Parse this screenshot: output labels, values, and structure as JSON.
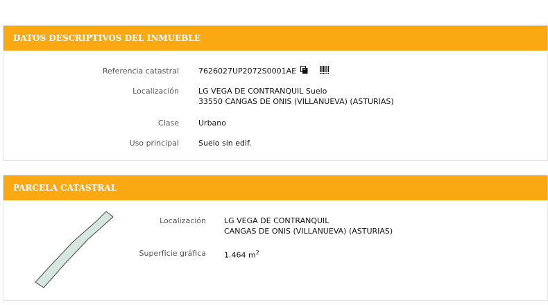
{
  "datos": {
    "title": "DATOS DESCRIPTIVOS DEL INMUEBLE",
    "referencia_label": "Referencia catastral",
    "referencia_value": "7626027UP2072S0001AE",
    "localizacion_label": "Localización",
    "localizacion_line1": "LG VEGA DE CONTRANQUIL Suelo",
    "localizacion_line2": "33550 CANGAS DE ONIS (VILLANUEVA) (ASTURIAS)",
    "clase_label": "Clase",
    "clase_value": "Urbano",
    "uso_label": "Uso principal",
    "uso_value": "Suelo sin edif."
  },
  "parcela": {
    "title": "PARCELA CATASTRAL",
    "localizacion_label": "Localización",
    "localizacion_line1": "LG VEGA DE CONTRANQUIL",
    "localizacion_line2": "CANGAS DE ONIS (VILLANUEVA) (ASTURIAS)",
    "superficie_label": "Superficie gráfica",
    "superficie_value": "1.464 m",
    "superficie_unit_sup": "2"
  },
  "icons": {
    "copy": "copy-icon",
    "barcode": "barcode-icon"
  },
  "colors": {
    "header_bg": "#fba912",
    "parcel_fill": "#d6e7df",
    "parcel_stroke": "#444444"
  }
}
